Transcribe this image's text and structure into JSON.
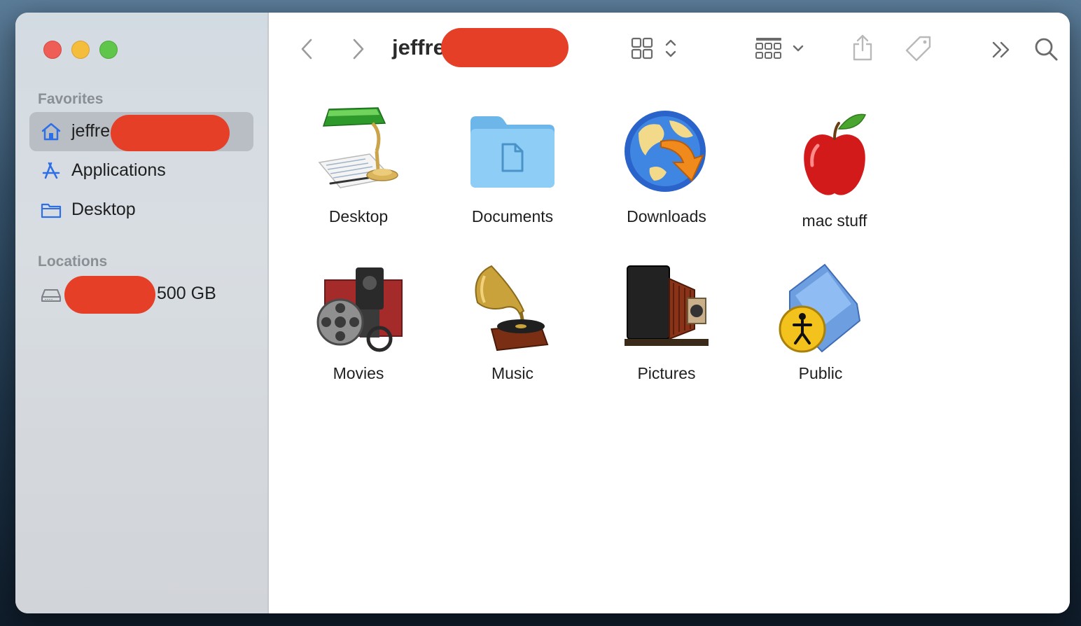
{
  "window": {
    "traffic_lights": [
      "close",
      "minimize",
      "maximize"
    ]
  },
  "sidebar": {
    "favorites_header": "Favorites",
    "locations_header": "Locations",
    "favorites": [
      {
        "label": "jeffre",
        "icon": "house-icon",
        "selected": true,
        "redacted": true
      },
      {
        "label": "Applications",
        "icon": "applications-icon",
        "selected": false
      },
      {
        "label": "Desktop",
        "icon": "folder-icon",
        "selected": false
      }
    ],
    "locations": [
      {
        "label": "500 GB",
        "icon": "drive-icon",
        "redacted": true
      }
    ]
  },
  "toolbar": {
    "title": "jeffre",
    "back_icon": "chevron-left-icon",
    "forward_icon": "chevron-right-icon",
    "view_icon": "grid-view-icon",
    "group_icon": "group-icon",
    "share_icon": "share-icon",
    "tag_icon": "tag-icon",
    "more_icon": "more-chevrons-icon",
    "search_icon": "search-icon"
  },
  "files": [
    {
      "label": "Desktop",
      "icon": "desktop-lamp-icon"
    },
    {
      "label": "Documents",
      "icon": "documents-folder-icon"
    },
    {
      "label": "Downloads",
      "icon": "downloads-globe-icon"
    },
    {
      "label": "mac stuff",
      "icon": "apple-icon"
    },
    {
      "label": "Movies",
      "icon": "movie-camera-icon"
    },
    {
      "label": "Music",
      "icon": "gramophone-icon"
    },
    {
      "label": "Pictures",
      "icon": "camera-icon"
    },
    {
      "label": "Public",
      "icon": "public-folder-icon"
    }
  ],
  "colors": {
    "accent": "#2f6fe6",
    "redaction": "#e53f28",
    "sidebar_selected": "#b9bec4"
  }
}
